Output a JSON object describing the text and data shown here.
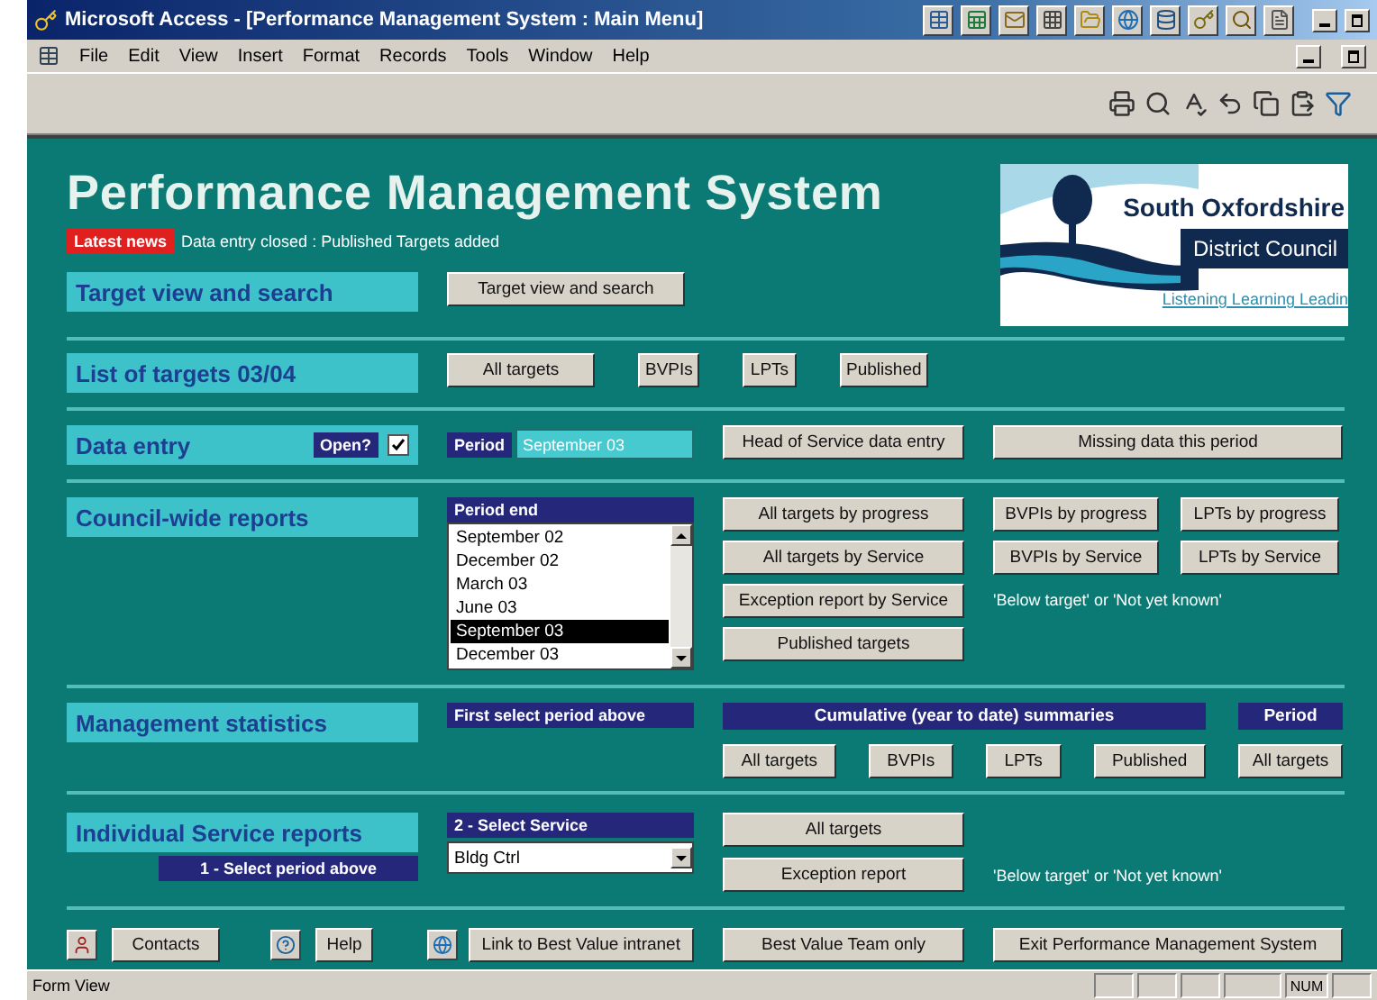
{
  "window": {
    "title": "Microsoft Access - [Performance Management System : Main Menu]"
  },
  "menu": [
    "File",
    "Edit",
    "View",
    "Insert",
    "Format",
    "Records",
    "Tools",
    "Window",
    "Help"
  ],
  "header": {
    "title": "Performance Management System",
    "news_label": "Latest news",
    "news_text": "Data entry closed : Published Targets added",
    "logo": {
      "name": "South Oxfordshire",
      "subtitle": "District Council",
      "tagline": "Listening Learning Leadin"
    }
  },
  "target_view": {
    "label": "Target view and search",
    "button": "Target view and search"
  },
  "target_list": {
    "label": "List of targets 03/04",
    "buttons": [
      "All targets",
      "BVPIs",
      "LPTs",
      "Published"
    ]
  },
  "data_entry": {
    "label": "Data entry",
    "open_label": "Open?",
    "open": true,
    "period_label": "Period",
    "period_value": "September 03",
    "buttons": [
      "Head of Service data entry",
      "Missing data this period"
    ]
  },
  "council_reports": {
    "label": "Council-wide reports",
    "period_header": "Period end",
    "periods": [
      {
        "label": "September 02",
        "selected": false
      },
      {
        "label": "December 02",
        "selected": false
      },
      {
        "label": "March 03",
        "selected": false
      },
      {
        "label": "June 03",
        "selected": false
      },
      {
        "label": "September 03",
        "selected": true
      },
      {
        "label": "December 03",
        "selected": false
      }
    ],
    "main_buttons": [
      "All targets by progress",
      "All targets by Service",
      "Exception report by Service",
      "Published targets"
    ],
    "side_buttons": [
      "BVPIs by progress",
      "LPTs by progress",
      "BVPIs by Service",
      "LPTs by Service"
    ],
    "note": "'Below target' or 'Not yet known'"
  },
  "management_stats": {
    "label": "Management statistics",
    "hint": "First select period above",
    "cumulative_header": "Cumulative (year to date) summaries",
    "period_header": "Period",
    "cumulative_buttons": [
      "All targets",
      "BVPIs",
      "LPTs",
      "Published"
    ],
    "period_buttons": [
      "All targets"
    ]
  },
  "service_reports": {
    "label": "Individual Service reports",
    "step1": "1 - Select period above",
    "step2": "2 - Select Service",
    "service": "Bldg Ctrl",
    "buttons": [
      "All targets",
      "Exception report"
    ],
    "note": "'Below target' or 'Not yet known'"
  },
  "footer": {
    "contacts": "Contacts",
    "help": "Help",
    "intranet": "Link to Best Value intranet",
    "team": "Best Value Team only",
    "exit": "Exit Performance Management System"
  },
  "status_bar": {
    "text": "Form View",
    "indicator": "NUM"
  }
}
